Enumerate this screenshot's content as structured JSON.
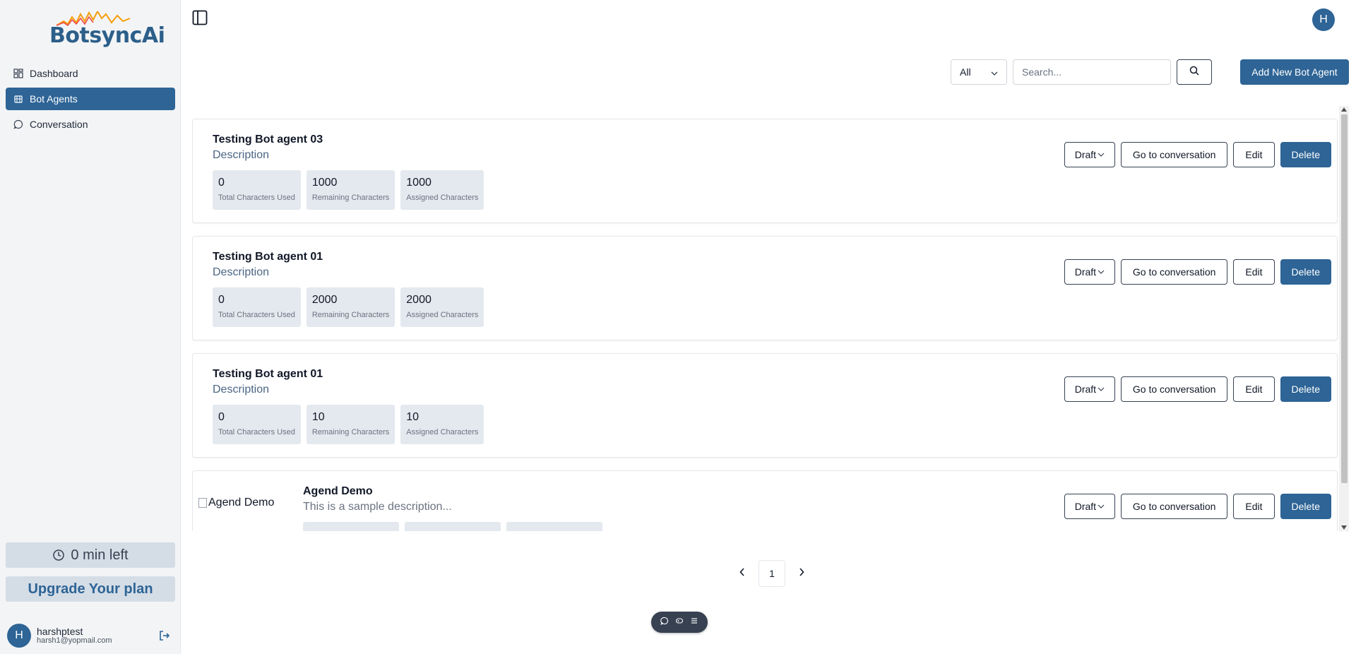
{
  "brand": {
    "logo_text_main": "Botsync",
    "logo_text_ai": "Ai"
  },
  "sidebar": {
    "items": [
      {
        "label": "Dashboard",
        "icon": "dashboard-icon"
      },
      {
        "label": "Bot Agents",
        "icon": "bot-icon",
        "active": true
      },
      {
        "label": "Conversation",
        "icon": "chat-icon"
      }
    ],
    "time_left": "0 min left",
    "upgrade_label": "Upgrade Your plan",
    "user": {
      "initial": "H",
      "name": "harshptest",
      "email": "harsh1@yopmail.com"
    }
  },
  "header": {
    "avatar_initial": "H"
  },
  "toolbar": {
    "filter_value": "All",
    "search_placeholder": "Search...",
    "add_label": "Add New Bot Agent"
  },
  "agents": [
    {
      "title": "Testing Bot agent 03",
      "description": "Description",
      "stats": [
        {
          "value": "0",
          "label": "Total Characters Used"
        },
        {
          "value": "1000",
          "label": "Remaining Characters"
        },
        {
          "value": "1000",
          "label": "Assigned Characters"
        }
      ],
      "status": "Draft",
      "goto_label": "Go to conversation",
      "edit_label": "Edit",
      "delete_label": "Delete"
    },
    {
      "title": "Testing Bot agent 01",
      "description": "Description",
      "stats": [
        {
          "value": "0",
          "label": "Total Characters Used"
        },
        {
          "value": "2000",
          "label": "Remaining Characters"
        },
        {
          "value": "2000",
          "label": "Assigned Characters"
        }
      ],
      "status": "Draft",
      "goto_label": "Go to conversation",
      "edit_label": "Edit",
      "delete_label": "Delete"
    },
    {
      "title": "Testing Bot agent 01",
      "description": "Description",
      "stats": [
        {
          "value": "0",
          "label": "Total Characters Used"
        },
        {
          "value": "10",
          "label": "Remaining Characters"
        },
        {
          "value": "10",
          "label": "Assigned Characters"
        }
      ],
      "status": "Draft",
      "goto_label": "Go to conversation",
      "edit_label": "Edit",
      "delete_label": "Delete"
    },
    {
      "image_alt": "Agend Demo",
      "title": "Agend Demo",
      "description": "This is a sample description...",
      "status": "Draft",
      "goto_label": "Go to conversation",
      "edit_label": "Edit",
      "delete_label": "Delete"
    }
  ],
  "pagination": {
    "current_page": "1"
  },
  "colors": {
    "primary": "#2e6496",
    "sidebar_bg": "#f3f4f6",
    "stat_bg": "#e4e9ef"
  }
}
